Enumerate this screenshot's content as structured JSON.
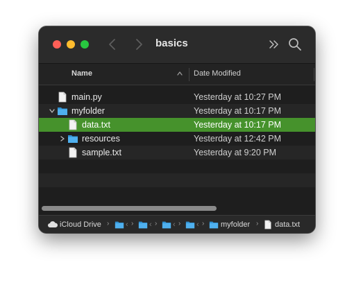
{
  "window": {
    "title": "basics"
  },
  "columns": {
    "name": "Name",
    "date": "Date Modified"
  },
  "files": [
    {
      "name": "main.py",
      "date": "Yesterday at 10:27 PM",
      "kind": "file",
      "indent": 0
    },
    {
      "name": "myfolder",
      "date": "Yesterday at 10:17 PM",
      "kind": "folder-open",
      "indent": 0
    },
    {
      "name": "data.txt",
      "date": "Yesterday at 10:17 PM",
      "kind": "file",
      "indent": 1,
      "selected": true
    },
    {
      "name": "resources",
      "date": "Yesterday at 12:42 PM",
      "kind": "folder",
      "indent": 1
    },
    {
      "name": "sample.txt",
      "date": "Yesterday at 9:20 PM",
      "kind": "file",
      "indent": 1
    }
  ],
  "path_bar": {
    "root": "iCloud Drive",
    "truncated": [
      "‹",
      "‹",
      "‹",
      "‹"
    ],
    "folder": "myfolder",
    "file": "data.txt"
  },
  "colors": {
    "selection": "#46922c",
    "folder": "#3aa3e3",
    "window_bg": "#1e1e1e"
  }
}
